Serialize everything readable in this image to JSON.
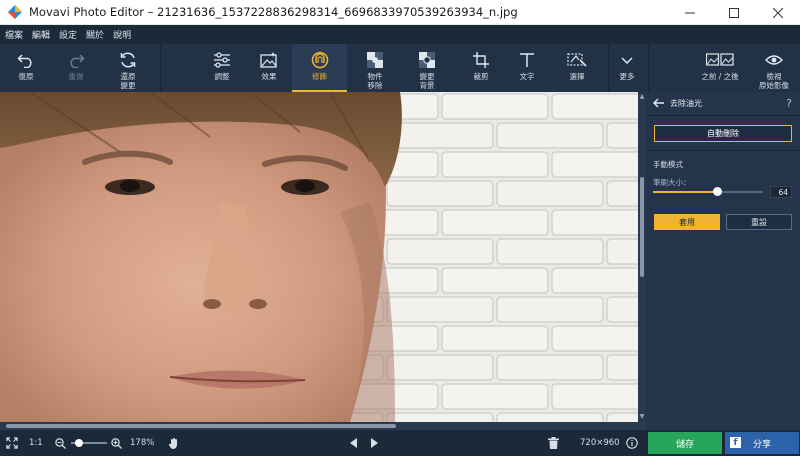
{
  "window": {
    "title": "Movavi Photo Editor – 21231636_1537228836298314_6696833970539263934_n.jpg"
  },
  "menu": [
    "檔案",
    "編輯",
    "設定",
    "關於",
    "說明"
  ],
  "toolbar": {
    "undo": "復原",
    "redo": "重做",
    "restore_original": [
      "還原",
      "變更"
    ],
    "adjust": "調整",
    "effects": "效果",
    "retouch": "修飾",
    "object_removal": [
      "物件",
      "移除"
    ],
    "change_background": [
      "變更",
      "背景"
    ],
    "crop": "裁剪",
    "text": "文字",
    "select": "選擇",
    "more": "更多",
    "before_after": "之前 / 之後",
    "view_original": [
      "檢視",
      "原始影像"
    ]
  },
  "panel": {
    "title": "去除油光",
    "help": "?",
    "auto_remove": "自動刪除",
    "manual_mode": "手動模式",
    "brush_size_label": "筆刷大小：",
    "brush_size": "64",
    "brush_fraction": 0.58,
    "apply": "套用",
    "reset": "重設"
  },
  "bottom": {
    "ratio": "1:1",
    "zoom": "178%",
    "zoom_fraction": 0.22,
    "dimensions": "720×960",
    "save": "儲存",
    "share": "分享",
    "share_glyph": "f"
  },
  "colors": {
    "accent": "#f2b233",
    "save": "#27a55a",
    "share": "#2c62a8"
  }
}
